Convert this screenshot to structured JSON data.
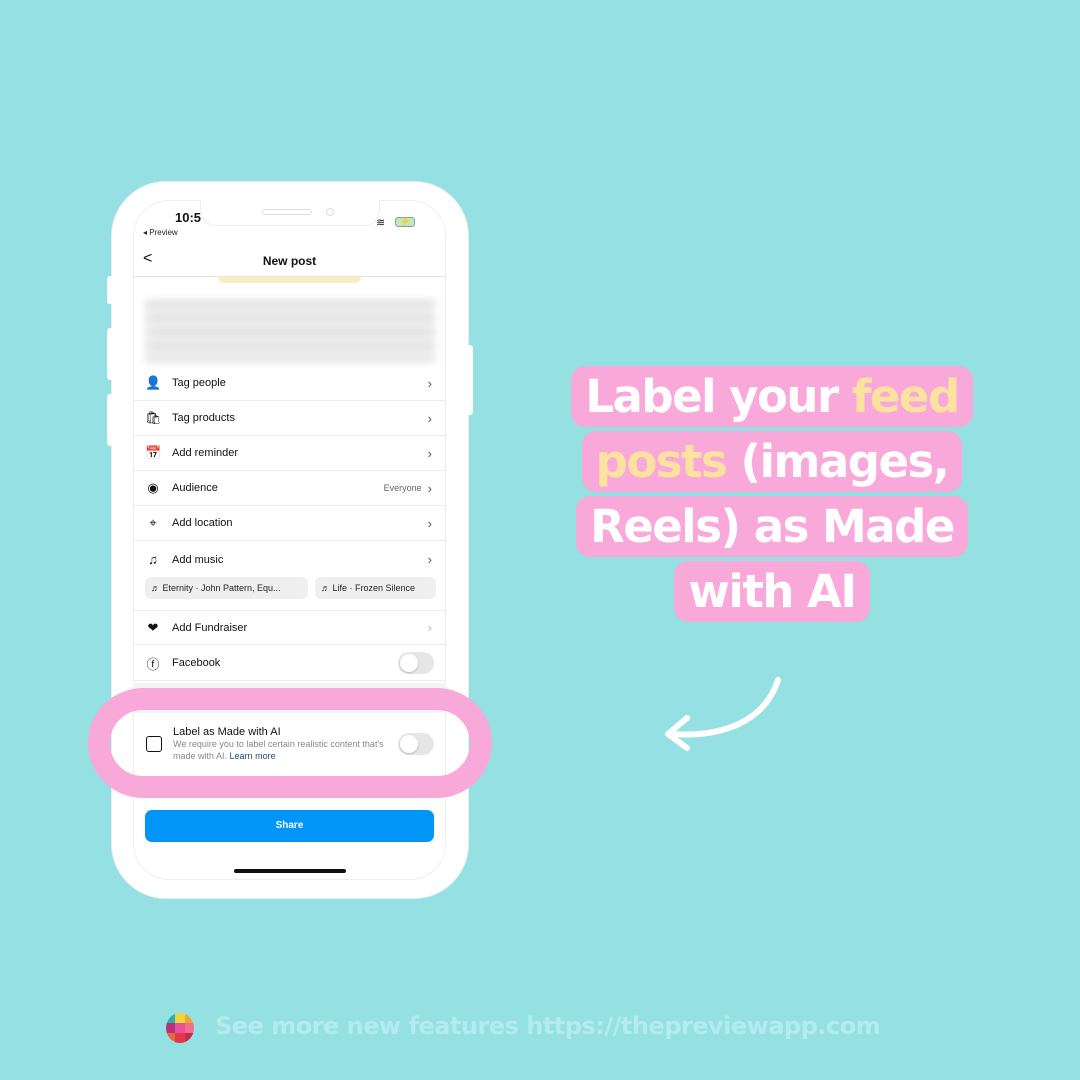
{
  "status_bar": {
    "time": "10:5",
    "back_app": "◂ Preview"
  },
  "header": {
    "title": "New post",
    "back": "<"
  },
  "rows": [
    {
      "label": "Tag people",
      "icon": "tag-people-icon",
      "glyph": "👤"
    },
    {
      "label": "Tag products",
      "icon": "shopping-bag-icon",
      "glyph": "🛍"
    },
    {
      "label": "Add reminder",
      "icon": "calendar-icon",
      "glyph": "📅"
    },
    {
      "label": "Audience",
      "icon": "eye-icon",
      "glyph": "◉",
      "value": "Everyone"
    },
    {
      "label": "Add location",
      "icon": "location-pin-icon",
      "glyph": "⌖"
    },
    {
      "label": "Add music",
      "icon": "music-note-icon",
      "glyph": "♫"
    },
    {
      "label": "Add Fundraiser",
      "icon": "fundraiser-icon",
      "glyph": "❤"
    },
    {
      "label": "Facebook",
      "icon": "facebook-icon",
      "glyph": "ⓕ"
    }
  ],
  "music_chips": [
    "♬ Eternity · John Pattern, Equ...",
    "♬ Life · Frozen Silence"
  ],
  "ai_label": {
    "title": "Label as Made with AI",
    "description": "We require you to label certain realistic content that's made with AI.",
    "link": "Learn more"
  },
  "share": "Share",
  "callout": {
    "part1": "Label your ",
    "highlight": "feed posts",
    "part2": " (images, Reels) as Made with AI"
  },
  "footer": "See more new features https://thepreviewapp.com",
  "colors": {
    "background": "#95E0E2",
    "pink": "#F9A8DA",
    "highlight": "#FBE29F",
    "share": "#0095F6"
  }
}
